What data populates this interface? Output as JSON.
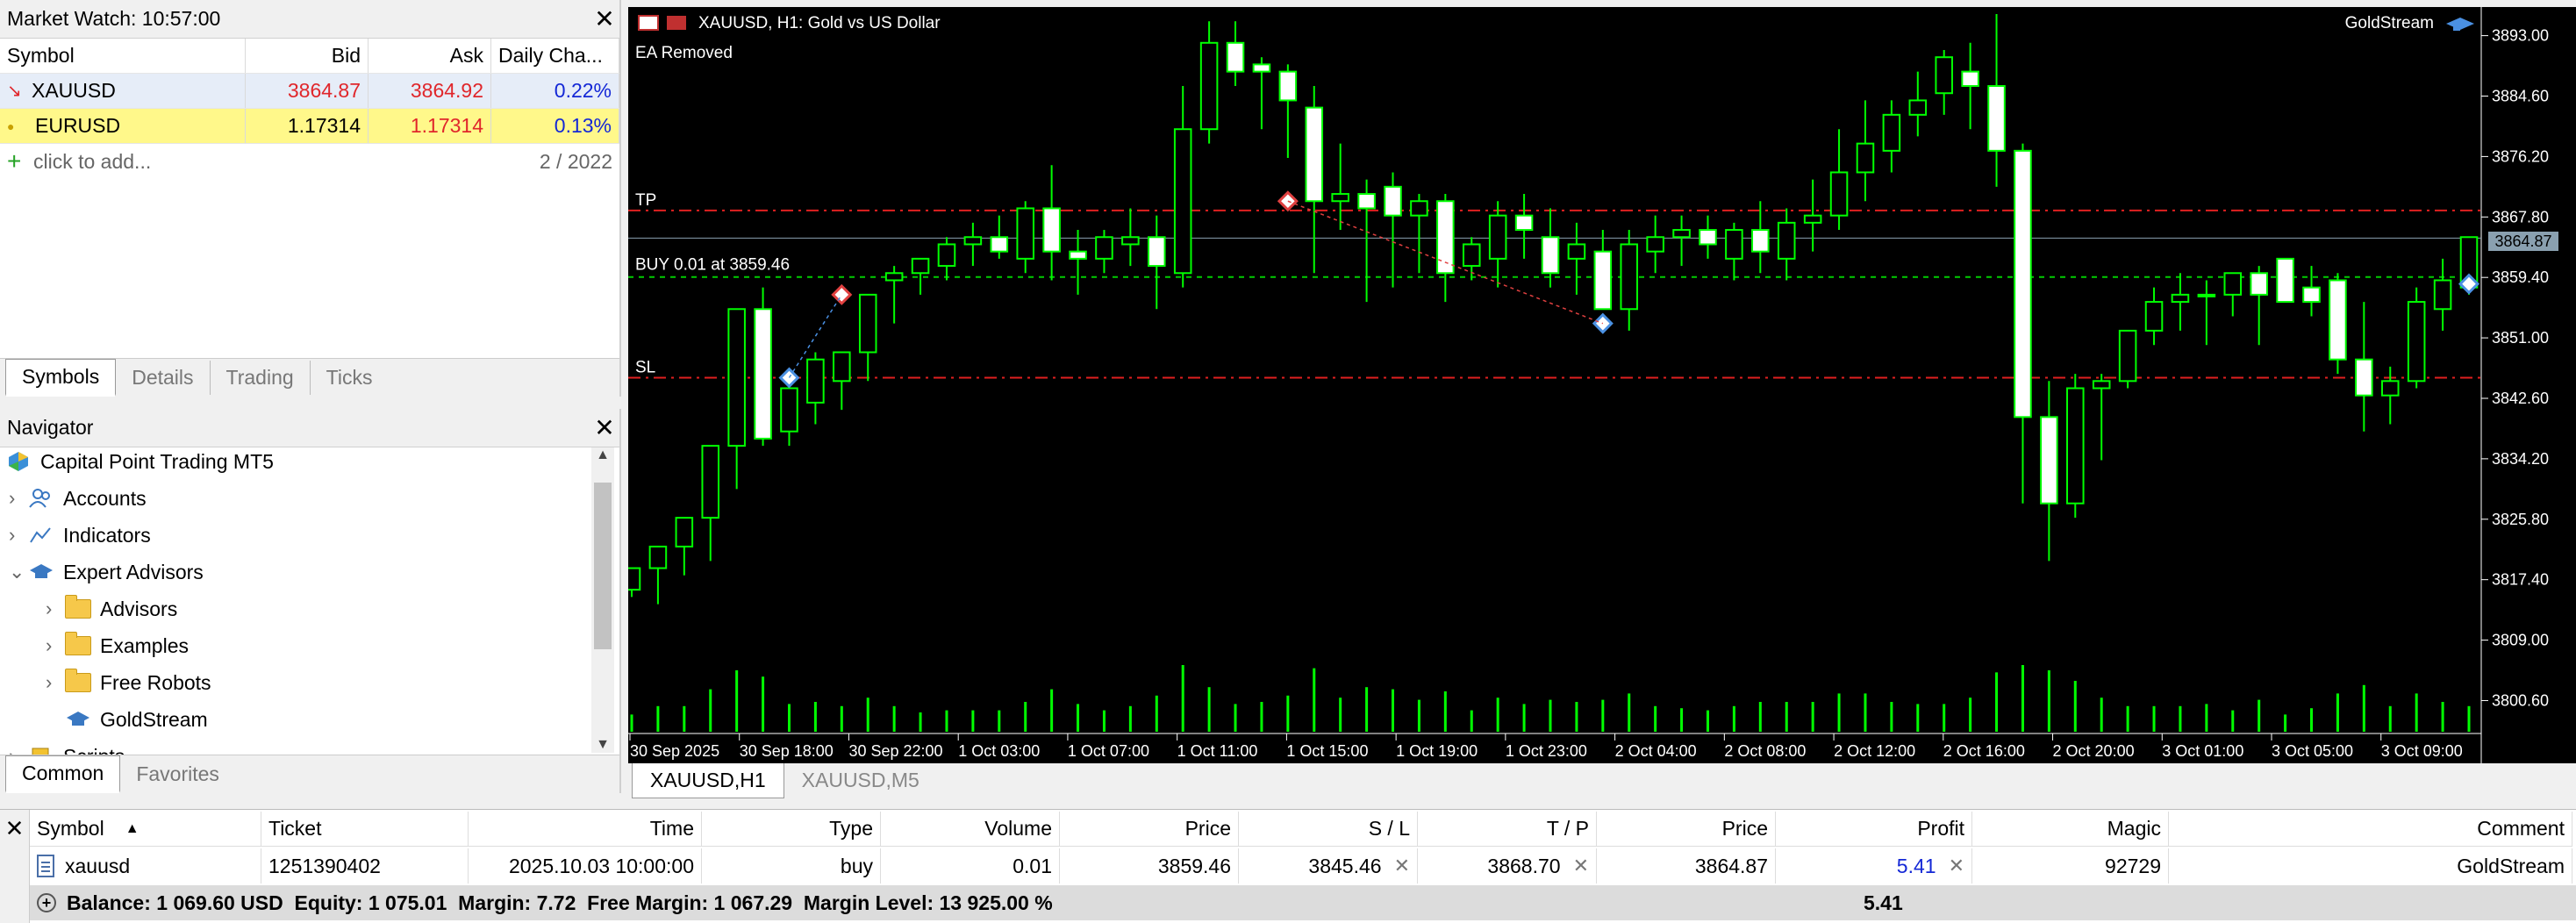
{
  "market_watch": {
    "title": "Market Watch: 10:57:00",
    "columns": [
      "Symbol",
      "Bid",
      "Ask",
      "Daily Cha..."
    ],
    "rows": [
      {
        "symbol": "XAUUSD",
        "bid": "3864.87",
        "ask": "3864.92",
        "change": "0.22%"
      },
      {
        "symbol": "EURUSD",
        "bid": "1.17314",
        "ask": "1.17314",
        "change": "0.13%"
      }
    ],
    "add_label": "click to add...",
    "count": "2 / 2022",
    "tabs": [
      "Symbols",
      "Details",
      "Trading",
      "Ticks"
    ]
  },
  "navigator": {
    "title": "Navigator",
    "items": [
      "Capital Point Trading MT5",
      "Accounts",
      "Indicators",
      "Expert Advisors",
      "Advisors",
      "Examples",
      "Free Robots",
      "GoldStream",
      "Scripts"
    ],
    "tabs": [
      "Common",
      "Favorites"
    ]
  },
  "chart": {
    "symbol_title": "XAUUSD, H1:  Gold vs US Dollar",
    "ea_status": "EA Removed",
    "ea_name": "GoldStream",
    "tp_label": "TP",
    "sl_label": "SL",
    "buy_label": "BUY 0.01 at 3859.46",
    "current_price": "3864.87",
    "tabs": [
      "XAUUSD,H1",
      "XAUUSD,M5"
    ],
    "colors": {
      "bull": "#00ff00",
      "bear_body": "#ffffff",
      "tp_sl_line": "#e02020",
      "entry_line": "#00cc00",
      "price_line": "#8aa0b0"
    }
  },
  "chart_data": {
    "type": "candlestick",
    "y_ticks": [
      "3893.00",
      "3884.60",
      "3876.20",
      "3867.80",
      "3859.40",
      "3851.00",
      "3842.60",
      "3834.20",
      "3825.80",
      "3817.40",
      "3809.00",
      "3800.60"
    ],
    "ylim": [
      3797.0,
      3896.0
    ],
    "x_ticks": [
      "30 Sep 2025",
      "30 Sep 18:00",
      "30 Sep 22:00",
      "1 Oct 03:00",
      "1 Oct 07:00",
      "1 Oct 11:00",
      "1 Oct 15:00",
      "1 Oct 19:00",
      "1 Oct 23:00",
      "2 Oct 04:00",
      "2 Oct 08:00",
      "2 Oct 12:00",
      "2 Oct 16:00",
      "2 Oct 20:00",
      "3 Oct 01:00",
      "3 Oct 05:00",
      "3 Oct 09:00"
    ],
    "levels": {
      "tp": 3868.7,
      "sl": 3845.46,
      "entry": 3859.46,
      "bid": 3864.87
    },
    "candles": [
      [
        3816.0,
        3819.0,
        3815.0,
        3819.0
      ],
      [
        3819.0,
        3822.0,
        3814.0,
        3822.0
      ],
      [
        3822.0,
        3826.0,
        3818.0,
        3826.0
      ],
      [
        3826.0,
        3836.0,
        3820.0,
        3836.0
      ],
      [
        3836.0,
        3855.0,
        3830.0,
        3855.0
      ],
      [
        3855.0,
        3858.0,
        3836.0,
        3837.0
      ],
      [
        3838.0,
        3845.0,
        3836.0,
        3844.0
      ],
      [
        3842.0,
        3849.0,
        3839.0,
        3848.0
      ],
      [
        3845.0,
        3849.0,
        3841.0,
        3849.0
      ],
      [
        3849.0,
        3857.0,
        3845.0,
        3857.0
      ],
      [
        3859.0,
        3861.0,
        3853.0,
        3860.0
      ],
      [
        3860.0,
        3862.0,
        3857.0,
        3862.0
      ],
      [
        3861.0,
        3865.0,
        3859.0,
        3864.0
      ],
      [
        3864.0,
        3867.0,
        3861.0,
        3865.0
      ],
      [
        3865.0,
        3868.0,
        3862.0,
        3863.0
      ],
      [
        3862.0,
        3870.0,
        3860.0,
        3869.0
      ],
      [
        3869.0,
        3875.0,
        3859.0,
        3863.0
      ],
      [
        3863.0,
        3866.0,
        3857.0,
        3862.0
      ],
      [
        3862.0,
        3866.0,
        3860.0,
        3865.0
      ],
      [
        3864.0,
        3869.0,
        3861.0,
        3865.0
      ],
      [
        3865.0,
        3868.0,
        3855.0,
        3861.0
      ],
      [
        3860.0,
        3886.0,
        3858.0,
        3880.0
      ],
      [
        3880.0,
        3895.0,
        3878.0,
        3892.0
      ],
      [
        3892.0,
        3895.0,
        3886.0,
        3888.0
      ],
      [
        3889.0,
        3890.0,
        3880.0,
        3888.0
      ],
      [
        3888.0,
        3889.0,
        3876.0,
        3884.0
      ],
      [
        3883.0,
        3886.0,
        3860.0,
        3870.0
      ],
      [
        3870.0,
        3878.0,
        3866.0,
        3871.0
      ],
      [
        3871.0,
        3873.0,
        3856.0,
        3869.0
      ],
      [
        3872.0,
        3874.0,
        3858.0,
        3868.0
      ],
      [
        3868.0,
        3871.0,
        3860.0,
        3870.0
      ],
      [
        3870.0,
        3871.0,
        3856.0,
        3860.0
      ],
      [
        3861.0,
        3865.0,
        3859.0,
        3864.0
      ],
      [
        3862.0,
        3870.0,
        3858.0,
        3868.0
      ],
      [
        3868.0,
        3871.0,
        3862.0,
        3866.0
      ],
      [
        3865.0,
        3869.0,
        3858.0,
        3860.0
      ],
      [
        3862.0,
        3867.0,
        3857.0,
        3864.0
      ],
      [
        3863.0,
        3866.0,
        3855.0,
        3855.0
      ],
      [
        3855.0,
        3866.0,
        3852.0,
        3864.0
      ],
      [
        3863.0,
        3868.0,
        3860.0,
        3865.0
      ],
      [
        3865.0,
        3868.0,
        3861.0,
        3866.0
      ],
      [
        3866.0,
        3868.0,
        3862.0,
        3864.0
      ],
      [
        3862.0,
        3867.0,
        3859.0,
        3866.0
      ],
      [
        3866.0,
        3870.0,
        3860.0,
        3863.0
      ],
      [
        3862.0,
        3869.0,
        3859.0,
        3867.0
      ],
      [
        3867.0,
        3873.0,
        3863.0,
        3868.0
      ],
      [
        3868.0,
        3880.0,
        3866.0,
        3874.0
      ],
      [
        3874.0,
        3884.0,
        3870.0,
        3878.0
      ],
      [
        3877.0,
        3884.0,
        3874.0,
        3882.0
      ],
      [
        3882.0,
        3888.0,
        3879.0,
        3884.0
      ],
      [
        3885.0,
        3891.0,
        3882.0,
        3890.0
      ],
      [
        3888.0,
        3892.0,
        3880.0,
        3886.0
      ],
      [
        3886.0,
        3896.0,
        3872.0,
        3877.0
      ],
      [
        3877.0,
        3878.0,
        3828.0,
        3840.0
      ],
      [
        3840.0,
        3845.0,
        3820.0,
        3828.0
      ],
      [
        3828.0,
        3846.0,
        3826.0,
        3844.0
      ],
      [
        3844.0,
        3846.0,
        3834.0,
        3845.0
      ],
      [
        3845.0,
        3852.0,
        3844.0,
        3852.0
      ],
      [
        3852.0,
        3858.0,
        3850.0,
        3856.0
      ],
      [
        3856.0,
        3860.0,
        3852.0,
        3857.0
      ],
      [
        3857.0,
        3859.0,
        3850.0,
        3857.0
      ],
      [
        3857.0,
        3860.0,
        3854.0,
        3860.0
      ],
      [
        3860.0,
        3861.0,
        3850.0,
        3857.0
      ],
      [
        3862.0,
        3861.0,
        3857.0,
        3856.0
      ],
      [
        3858.0,
        3861.0,
        3854.0,
        3856.0
      ],
      [
        3859.0,
        3860.0,
        3846.0,
        3848.0
      ],
      [
        3848.0,
        3856.0,
        3838.0,
        3843.0
      ],
      [
        3843.0,
        3847.0,
        3839.0,
        3845.0
      ],
      [
        3845.0,
        3858.0,
        3844.0,
        3856.0
      ],
      [
        3855.0,
        3862.0,
        3852.0,
        3859.0
      ],
      [
        3858.0,
        3865.0,
        3857.0,
        3865.0
      ]
    ]
  },
  "toolbox": {
    "columns": [
      "Symbol",
      "Ticket",
      "Time",
      "Type",
      "Volume",
      "Price",
      "S / L",
      "T / P",
      "Price",
      "Profit",
      "Magic",
      "Comment"
    ],
    "position": {
      "symbol": "xauusd",
      "ticket": "1251390402",
      "time": "2025.10.03 10:00:00",
      "type": "buy",
      "volume": "0.01",
      "price_open": "3859.46",
      "sl": "3845.46",
      "tp": "3868.70",
      "price_current": "3864.87",
      "profit": "5.41",
      "magic": "92729",
      "comment": "GoldStream"
    },
    "balance_line": "Balance: 1 069.60 USD  Equity: 1 075.01  Margin: 7.72  Free Margin: 1 067.29  Margin Level: 13 925.00 %",
    "total_profit": "5.41"
  }
}
